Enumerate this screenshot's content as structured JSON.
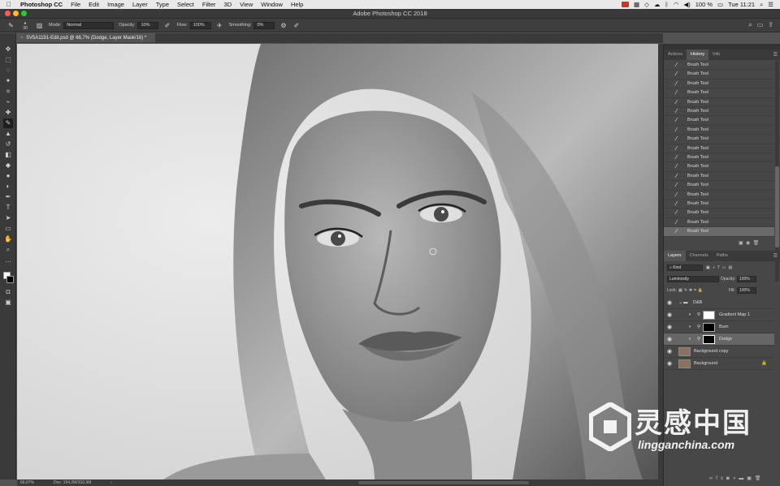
{
  "menubar": {
    "app": "Photoshop CC",
    "items": [
      "File",
      "Edit",
      "Image",
      "Layer",
      "Type",
      "Select",
      "Filter",
      "3D",
      "View",
      "Window",
      "Help"
    ],
    "battery": "100 %",
    "clock": "Tue 11:21"
  },
  "window": {
    "title": "Adobe Photoshop CC 2018"
  },
  "options": {
    "brush_size": "30",
    "mode_label": "Mode:",
    "mode_value": "Normal",
    "opacity_label": "Opacity:",
    "opacity_value": "10%",
    "flow_label": "Flow:",
    "flow_value": "100%",
    "smoothing_label": "Smoothing:",
    "smoothing_value": "0%"
  },
  "document": {
    "tab_label": "5V5A1191-Edit.psd @ 66,7% (Dodge, Layer Mask/16) *",
    "zoom": "66,67%",
    "doc_info": "Doc: 154,2M/310,9M"
  },
  "history_panel": {
    "tabs": [
      "Actions",
      "History",
      "Info"
    ],
    "active_tab": "History",
    "items": [
      "Brush Tool",
      "Brush Tool",
      "Brush Tool",
      "Brush Tool",
      "Brush Tool",
      "Brush Tool",
      "Brush Tool",
      "Brush Tool",
      "Brush Tool",
      "Brush Tool",
      "Brush Tool",
      "Brush Tool",
      "Brush Tool",
      "Brush Tool",
      "Brush Tool",
      "Brush Tool",
      "Brush Tool",
      "Brush Tool",
      "Brush Tool"
    ]
  },
  "layers_panel": {
    "tabs": [
      "Layers",
      "Channels",
      "Paths"
    ],
    "active_tab": "Layers",
    "filter_kind": "Kind",
    "blend_mode": "Luminosity",
    "opacity_label": "Opacity:",
    "opacity_value": "100%",
    "lock_label": "Lock:",
    "fill_label": "Fill:",
    "fill_value": "100%",
    "group_name": "D&B",
    "layers": [
      {
        "name": "Gradient Map 1",
        "thumb": "white"
      },
      {
        "name": "Burn",
        "thumb": "black"
      },
      {
        "name": "Dodge",
        "thumb": "black",
        "selected": true
      }
    ],
    "base_layers": [
      "Background copy",
      "Background"
    ]
  },
  "watermark": {
    "text": "灵感中国",
    "url": "lingganchina.com"
  },
  "colors": {
    "menubar_bg": "#e9e9e9",
    "chrome_dark": "#3a3a3a",
    "panel_bg": "#474747",
    "selection": "#6a6a6a"
  }
}
